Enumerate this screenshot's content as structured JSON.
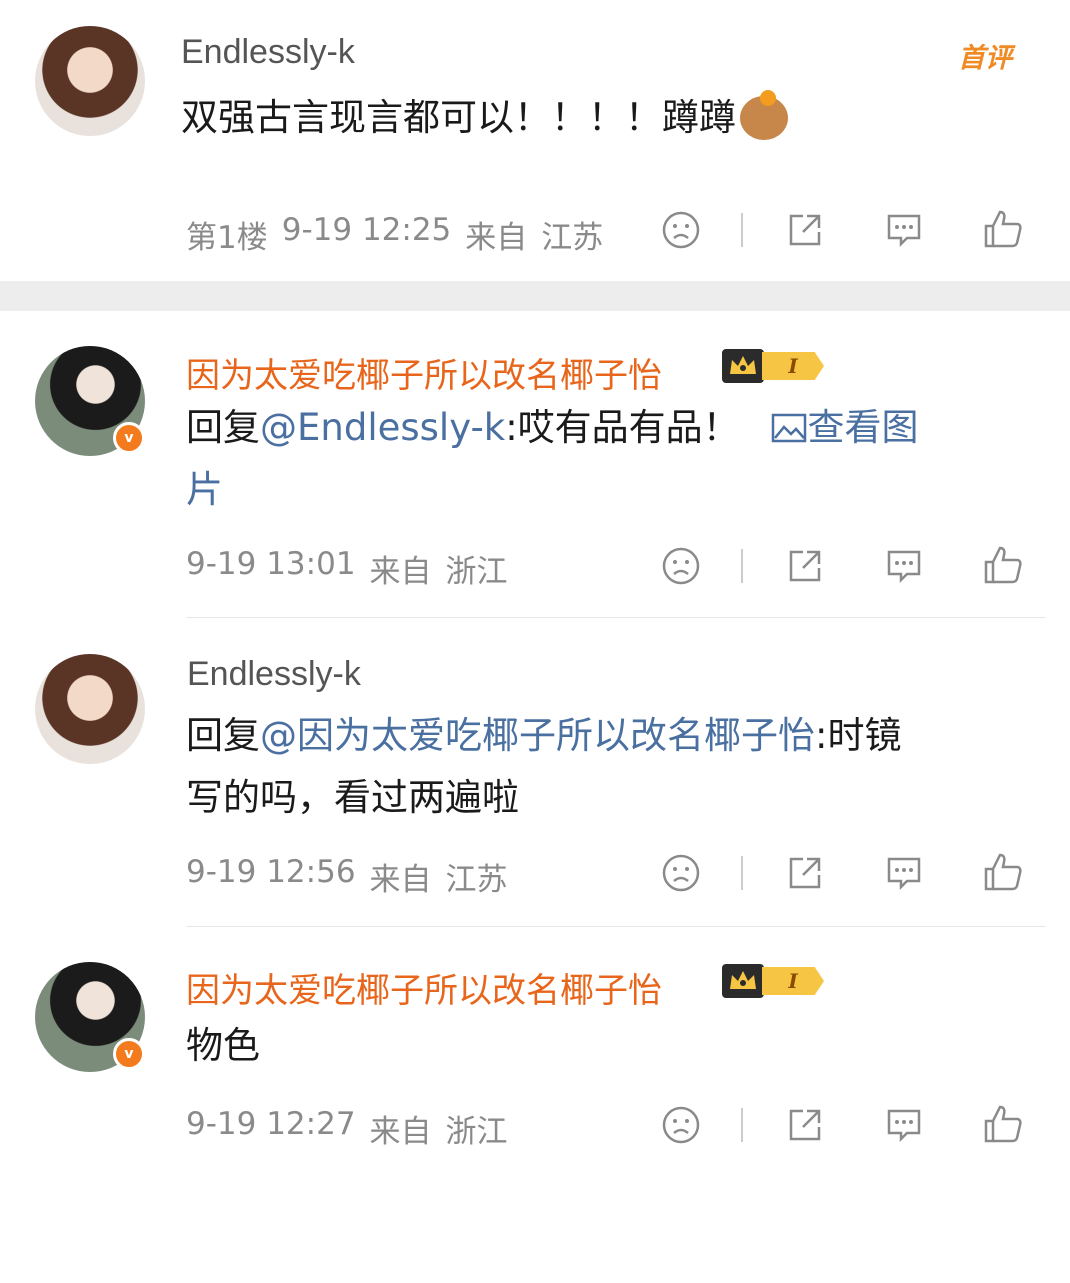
{
  "comments": [
    {
      "username": "Endlessly-k",
      "badge": "首评",
      "text": "双强古言现言都可以！！！！蹲蹲",
      "meta": {
        "floor": "第1楼",
        "time": "9-19 12:25",
        "from": "来自",
        "location": "江苏"
      }
    },
    {
      "username": "因为太爱吃椰子所以改名椰子怡",
      "crown_level": "I",
      "reply_prefix": "回复",
      "mention": "@Endlessly-k",
      "text_after": ":哎有品有品！",
      "picture_link": "查看图",
      "picture_link_wrap": "片",
      "meta": {
        "time": "9-19 13:01",
        "from": "来自",
        "location": "浙江"
      }
    },
    {
      "username": "Endlessly-k",
      "reply_prefix": "回复",
      "mention": "@因为太爱吃椰子所以改名椰子怡",
      "text_after": ":时镜",
      "text_line2": "写的吗，看过两遍啦",
      "meta": {
        "time": "9-19 12:56",
        "from": "来自",
        "location": "江苏"
      }
    },
    {
      "username": "因为太爱吃椰子所以改名椰子怡",
      "crown_level": "I",
      "text": "物色",
      "meta": {
        "time": "9-19 12:27",
        "from": "来自",
        "location": "浙江"
      }
    }
  ],
  "icons": [
    "sad-face-icon",
    "share-icon",
    "comment-icon",
    "like-icon",
    "crown-icon",
    "verified-icon",
    "image-icon"
  ],
  "colors": {
    "orange_name": "#e8661c",
    "link_blue": "#4a6fa1",
    "meta_gray": "#8a8a8a",
    "verified": "#f37b1d"
  }
}
